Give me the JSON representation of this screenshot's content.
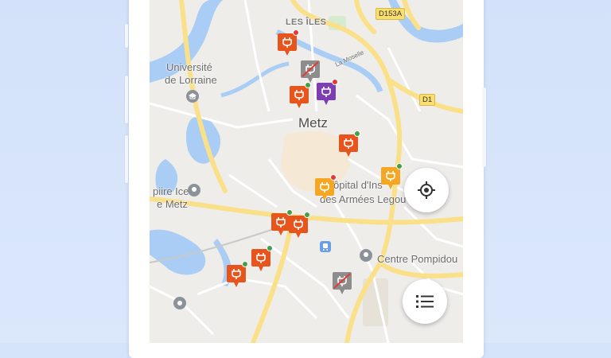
{
  "map": {
    "districts": [
      {
        "label": "LES ÎLES"
      }
    ],
    "places": [
      {
        "label": "Université"
      },
      {
        "label": "de Lorraine"
      },
      {
        "label": "Metz"
      },
      {
        "label": "ôpital d'Ins"
      },
      {
        "label": "des Armées Legou"
      },
      {
        "label": "Centre Pompidou"
      },
      {
        "label": "piire Ice"
      },
      {
        "label": "e Metz"
      }
    ],
    "road_tags": [
      {
        "label": "D153A"
      },
      {
        "label": "D1"
      }
    ],
    "street_label": "La Moselle"
  },
  "markers": [
    {
      "type": "charging-station",
      "color": "#e8551c",
      "status": "available",
      "status_color": "#e53935"
    },
    {
      "type": "charging-station-out-of-service",
      "color": "#8d8d8d"
    },
    {
      "type": "charging-station",
      "color": "#e8551c",
      "status": "available",
      "status_color": "#43a047"
    },
    {
      "type": "charging-station",
      "color": "#7b3fb0",
      "status": "available",
      "status_color": "#e53935"
    },
    {
      "type": "charging-station",
      "color": "#e8551c",
      "status": "available",
      "status_color": "#43a047"
    },
    {
      "type": "charging-station",
      "color": "#f5a623",
      "status": "available",
      "status_color": "#e53935"
    },
    {
      "type": "charging-station",
      "color": "#f5a623",
      "status": "available",
      "status_color": "#43a047"
    },
    {
      "type": "charging-station",
      "color": "#e8551c",
      "status": "available",
      "status_color": "#43a047"
    },
    {
      "type": "charging-station",
      "color": "#e8551c",
      "status": "available",
      "status_color": "#43a047"
    },
    {
      "type": "charging-station",
      "color": "#e8551c",
      "status": "available",
      "status_color": "#43a047"
    },
    {
      "type": "charging-station",
      "color": "#e8551c",
      "status": "available",
      "status_color": "#43a047"
    },
    {
      "type": "charging-station-out-of-service",
      "color": "#8d8d8d"
    }
  ],
  "controls": {
    "locate_icon": "my-location-icon",
    "list_icon": "list-icon"
  },
  "colors": {
    "background": "#d6e4fb",
    "map_base": "#eeedea",
    "water": "#a9cdf5",
    "major_road": "#fbe08a",
    "accent_orange": "#e8551c"
  }
}
